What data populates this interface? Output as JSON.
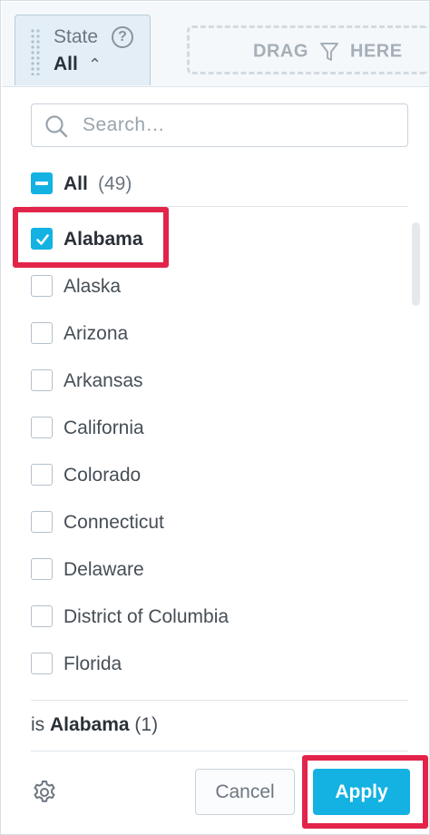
{
  "header": {
    "attribute_label": "State",
    "help_glyph": "?",
    "selected_value": "All",
    "caret_glyph": "⌃",
    "drop_zone": {
      "text_before": "DRAG",
      "text_after": "HERE",
      "icon": "funnel-icon"
    }
  },
  "search": {
    "placeholder": "Search…",
    "value": "",
    "icon": "search-icon"
  },
  "all_option": {
    "label": "All",
    "count": "(49)"
  },
  "items": [
    {
      "label": "Alabama",
      "checked": true
    },
    {
      "label": "Alaska",
      "checked": false
    },
    {
      "label": "Arizona",
      "checked": false
    },
    {
      "label": "Arkansas",
      "checked": false
    },
    {
      "label": "California",
      "checked": false
    },
    {
      "label": "Colorado",
      "checked": false
    },
    {
      "label": "Connecticut",
      "checked": false
    },
    {
      "label": "Delaware",
      "checked": false
    },
    {
      "label": "District of Columbia",
      "checked": false
    },
    {
      "label": "Florida",
      "checked": false
    }
  ],
  "summary": {
    "prefix": "is",
    "value": "Alabama",
    "count": "(1)"
  },
  "footer": {
    "settings_icon": "gear-icon",
    "cancel_label": "Cancel",
    "apply_label": "Apply"
  },
  "colors": {
    "accent": "#14b2e2",
    "highlight": "#e3244a",
    "text": "#464e56"
  }
}
